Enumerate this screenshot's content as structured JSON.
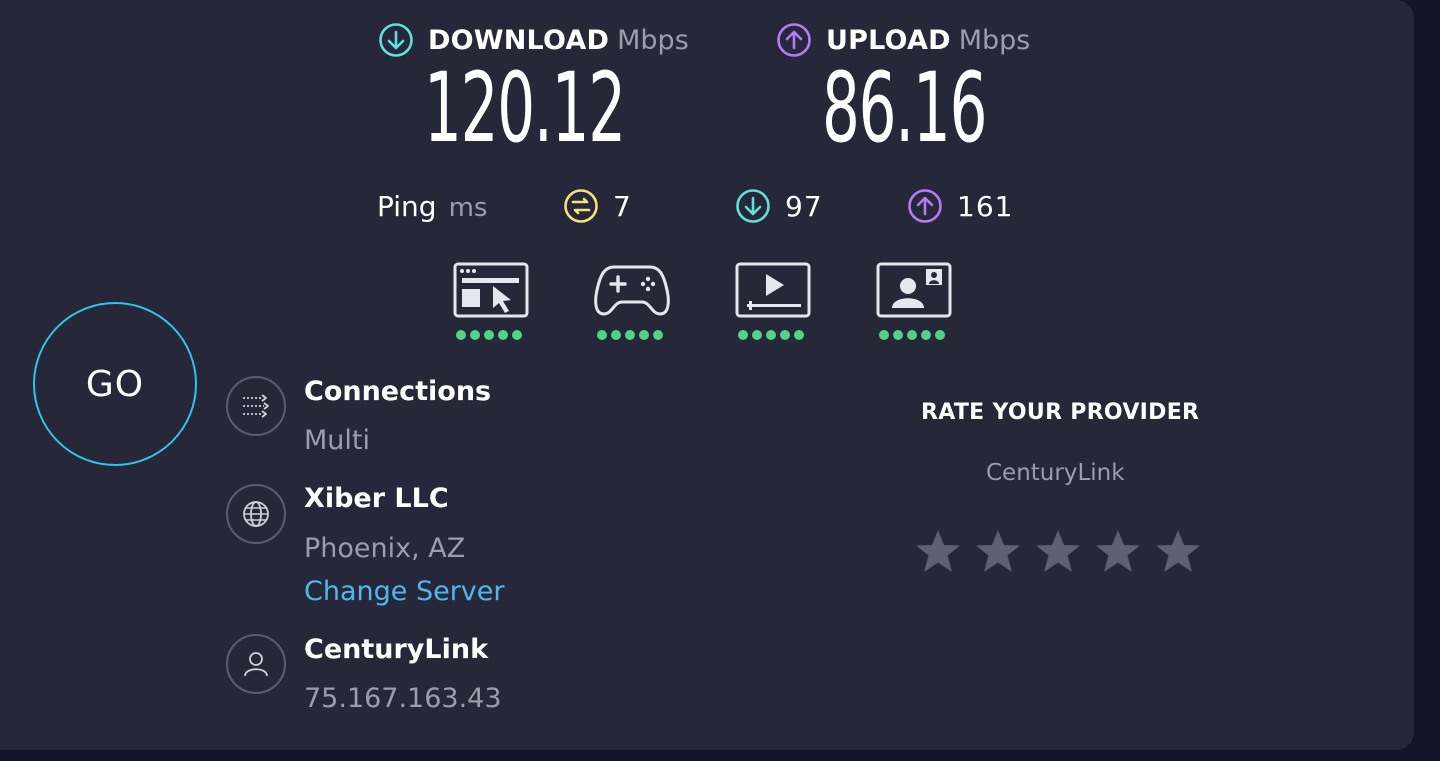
{
  "download": {
    "title": "DOWNLOAD",
    "unit": "Mbps",
    "value": "120.12"
  },
  "upload": {
    "title": "UPLOAD",
    "unit": "Mbps",
    "value": "86.16"
  },
  "ping": {
    "label": "Ping",
    "unit": "ms",
    "idle": "7",
    "download": "97",
    "upload": "161"
  },
  "usage": [
    {
      "icon": "web-browsing-icon",
      "rating": 5
    },
    {
      "icon": "gaming-icon",
      "rating": 5
    },
    {
      "icon": "video-streaming-icon",
      "rating": 5
    },
    {
      "icon": "video-chat-icon",
      "rating": 5
    }
  ],
  "go": {
    "label": "GO"
  },
  "connections": {
    "title": "Connections",
    "value": "Multi"
  },
  "server": {
    "name": "Xiber LLC",
    "location": "Phoenix, AZ",
    "change_label": "Change Server"
  },
  "provider": {
    "name": "CenturyLink",
    "ip": "75.167.163.43"
  },
  "rate": {
    "title": "RATE YOUR PROVIDER",
    "provider": "CenturyLink",
    "star_count": 5
  },
  "colors": {
    "download": "#5fe0da",
    "upload": "#b57bf4",
    "ping": "#f4e27d",
    "go_ring": "#32c4e8",
    "rating_dot": "#4fd582",
    "link": "#4fb7ef",
    "background": "#26283a"
  }
}
